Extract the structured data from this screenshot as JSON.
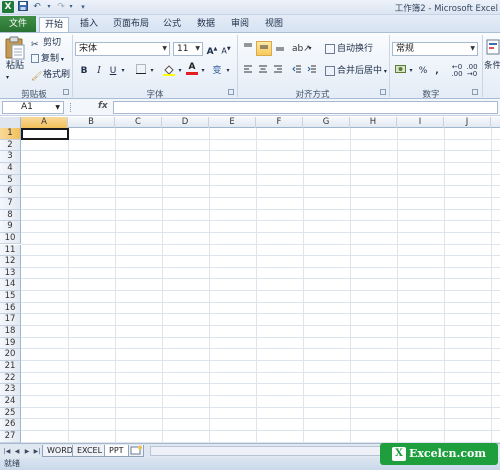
{
  "window": {
    "title": "工作簿2 - Microsoft Excel",
    "app_icon": "X",
    "qat": [
      {
        "name": "save-icon",
        "glyph": "💾"
      },
      {
        "name": "undo-icon",
        "glyph": "↶"
      },
      {
        "name": "redo-icon",
        "glyph": "↷"
      },
      {
        "name": "customize-qat-icon",
        "glyph": "▾"
      }
    ]
  },
  "tabs": {
    "file": "文件",
    "items": [
      "开始",
      "插入",
      "页面布局",
      "公式",
      "数据",
      "审阅",
      "视图"
    ],
    "active": "开始"
  },
  "ribbon": {
    "clipboard": {
      "paste": "粘贴",
      "cut": "剪切",
      "copy": "复制",
      "format_painter": "格式刷",
      "group_label": "剪贴板"
    },
    "font": {
      "font_name": "宋体",
      "font_size": "11",
      "grow": "A",
      "shrink": "A",
      "bold": "B",
      "italic": "I",
      "underline": "U",
      "phonetic": "变",
      "font_color_letter": "A",
      "group_label": "字体"
    },
    "alignment": {
      "wrap_text": "自动换行",
      "merge_center": "合并后居中",
      "group_label": "对齐方式"
    },
    "number": {
      "format": "常规",
      "percent": "%",
      "comma": ",",
      "group_label": "数字"
    },
    "styles": {
      "conditional": "条件"
    }
  },
  "formula_bar": {
    "name_box": "A1",
    "fx": "fx",
    "value": ""
  },
  "grid": {
    "columns": [
      "A",
      "B",
      "C",
      "D",
      "E",
      "F",
      "G",
      "H",
      "I",
      "J"
    ],
    "rows": [
      "1",
      "2",
      "3",
      "4",
      "5",
      "6",
      "7",
      "8",
      "9",
      "10",
      "11",
      "12",
      "13",
      "14",
      "15",
      "16",
      "17",
      "18",
      "19",
      "20",
      "21",
      "22",
      "23",
      "24",
      "25",
      "26",
      "27"
    ],
    "active_cell": "A1"
  },
  "sheets": {
    "tabs": [
      "WORD",
      "EXCEL",
      "PPT"
    ],
    "active": "PPT"
  },
  "status": {
    "text": "就绪"
  },
  "watermark": {
    "text": "Excelcn.com"
  }
}
